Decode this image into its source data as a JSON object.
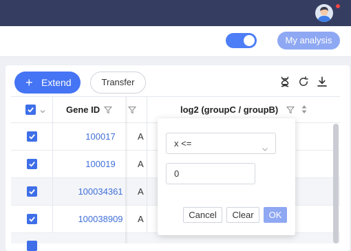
{
  "topbar": {
    "icons": [
      "dna-icon",
      "image-icon",
      "help-icon"
    ],
    "avatar": "user-avatar"
  },
  "subbar": {
    "toggle_on": true,
    "my_analysis_label": "My analysis"
  },
  "toolbar": {
    "extend_label": "Extend",
    "transfer_label": "Transfer",
    "icons": [
      "dna-icon",
      "refresh-icon",
      "download-icon"
    ]
  },
  "table": {
    "columns": {
      "gene_id": "Gene ID",
      "log2": "log2 (groupC / groupB)"
    },
    "rows": [
      {
        "checked": true,
        "gene_id": "100017",
        "col_a": "A"
      },
      {
        "checked": true,
        "gene_id": "100019",
        "col_a": "A"
      },
      {
        "checked": true,
        "gene_id": "100034361",
        "col_a": "A"
      },
      {
        "checked": true,
        "gene_id": "100038909",
        "col_a": "A"
      }
    ]
  },
  "filter_popover": {
    "operator": "x <=",
    "value": "0",
    "cancel_label": "Cancel",
    "clear_label": "Clear",
    "ok_label": "OK"
  },
  "colors": {
    "topbar": "#353d61",
    "primary": "#4574f4",
    "primary_light": "#8fa8f3",
    "link": "#3e6fd8"
  }
}
